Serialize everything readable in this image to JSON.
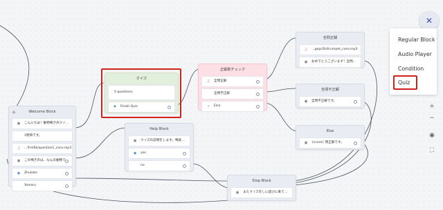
{
  "nodes": {
    "welcome": {
      "title": "Welcome Block",
      "rows": [
        {
          "icon": "chat-icon",
          "text": "こんにちは！動物鳴き声クイ…"
        },
        {
          "icon": "",
          "text": "1問目です。"
        },
        {
          "icon": "music-note-icon",
          "text": "…firstSk/question1_conv.mp3"
        },
        {
          "icon": "chat-icon",
          "text": "この鳴き声は、なんの動物で…"
        },
        {
          "icon": "user-icon",
          "text": "Zhukete"
        },
        {
          "icon": "",
          "text": "Yameru"
        }
      ]
    },
    "quiz": {
      "title": "クイズ",
      "rows": [
        {
          "icon": "",
          "text": "5 questions"
        },
        {
          "icon": "flag-icon",
          "text": "Finish Quiz"
        }
      ]
    },
    "help": {
      "title": "Help Block",
      "rows": [
        {
          "icon": "chat-icon",
          "text": "クイズの説明をします。鳴就…"
        },
        {
          "icon": "user-icon",
          "text": "yes"
        },
        {
          "icon": "",
          "text": "no"
        }
      ]
    },
    "condition": {
      "title": "正解数チェック",
      "rows": [
        {
          "icon": "music-note-icon",
          "text": "全問正解"
        },
        {
          "icon": "",
          "text": "全問不正解"
        },
        {
          "icon": "branch-icon",
          "text": "Else"
        }
      ]
    },
    "all_correct": {
      "title": "全問正解",
      "rows": [
        {
          "icon": "music-note-icon",
          "text": "…gepcDs/trumpet_conv.mp3"
        },
        {
          "icon": "chat-icon",
          "text": "おめでとうございます！全問…"
        }
      ]
    },
    "all_wrong": {
      "title": "全問不正解",
      "rows": [
        {
          "icon": "chat-icon",
          "text": "全問不正解です。"
        }
      ]
    },
    "else": {
      "title": "Else",
      "rows": [
        {
          "icon": "chat-icon",
          "text": "{score} 問正解です。"
        }
      ]
    },
    "stop": {
      "title": "Stop Block",
      "rows": [
        {
          "icon": "chat-icon",
          "text": "またクイズをしに遊びに来て…"
        }
      ]
    }
  },
  "menu": {
    "items": [
      "Regular Block",
      "Audio Player",
      "Condition",
      "Quiz"
    ],
    "selected": "Quiz"
  },
  "controls": {
    "close": "close-icon",
    "zoom_in": "plus-icon",
    "zoom_out": "minus-icon",
    "view": "eye-icon",
    "fit": "fit-screen-icon"
  },
  "colors": {
    "highlight": "#d0201b",
    "quiz_node": "#e3efdd",
    "condition_node": "#fde0e6"
  }
}
